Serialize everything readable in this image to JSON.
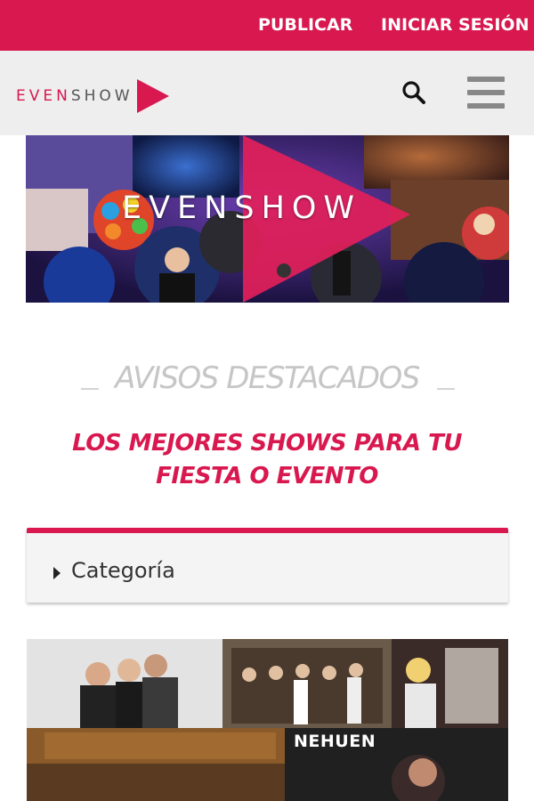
{
  "topbar": {
    "publish_label": "PUBLICAR",
    "login_label": "INICIAR SESIÓN"
  },
  "header": {
    "logo_even": "EVEN",
    "logo_show": "SHOW"
  },
  "banner": {
    "text": "EVENSHOW"
  },
  "featured": {
    "title": "AVISOS DESTACADOS",
    "tagline_line1": "LOS MEJORES SHOWS PARA TU",
    "tagline_line2": "FIESTA O EVENTO"
  },
  "filter": {
    "category_label": "Categoría"
  },
  "listing": {
    "brand_text": "NEHUEN"
  },
  "colors": {
    "brand": "#d8184f",
    "header_bg": "#eeeeee",
    "muted_title": "#c6c6c6"
  },
  "icons": [
    "search-icon",
    "hamburger-menu-icon",
    "play-triangle-icon",
    "caret-right-icon"
  ]
}
